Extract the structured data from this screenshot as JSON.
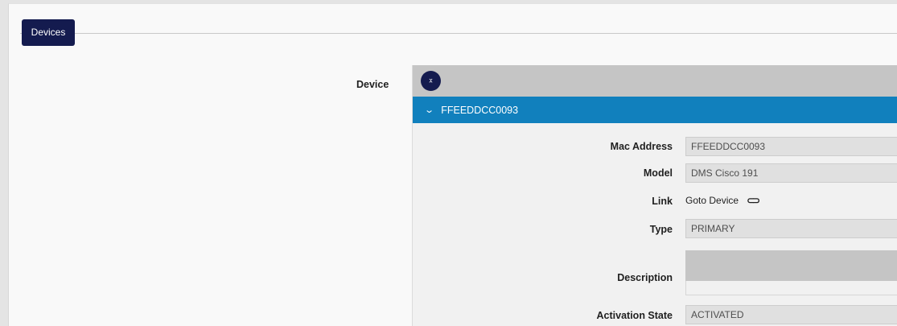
{
  "tabs": {
    "devices_label": "Devices"
  },
  "device": {
    "label": "Device",
    "accordion_title": "FFEEDDCC0093",
    "fields": {
      "mac_label": "Mac Address",
      "mac_value": "FFEEDDCC0093",
      "model_label": "Model",
      "model_value": "DMS Cisco 191",
      "link_label": "Link",
      "link_text": "Goto Device",
      "type_label": "Type",
      "type_value": "PRIMARY",
      "description_label": "Description",
      "description_value": "",
      "activation_label": "Activation State",
      "activation_value": "ACTIVATED"
    }
  },
  "icons": {
    "collapse": "collapse-expand-icon",
    "chevron": "chevron-down-icon",
    "link": "link-icon"
  },
  "colors": {
    "tab_bg": "#141b4f",
    "accordion_bg": "#1180bd",
    "header_bg": "#c5c5c5"
  }
}
